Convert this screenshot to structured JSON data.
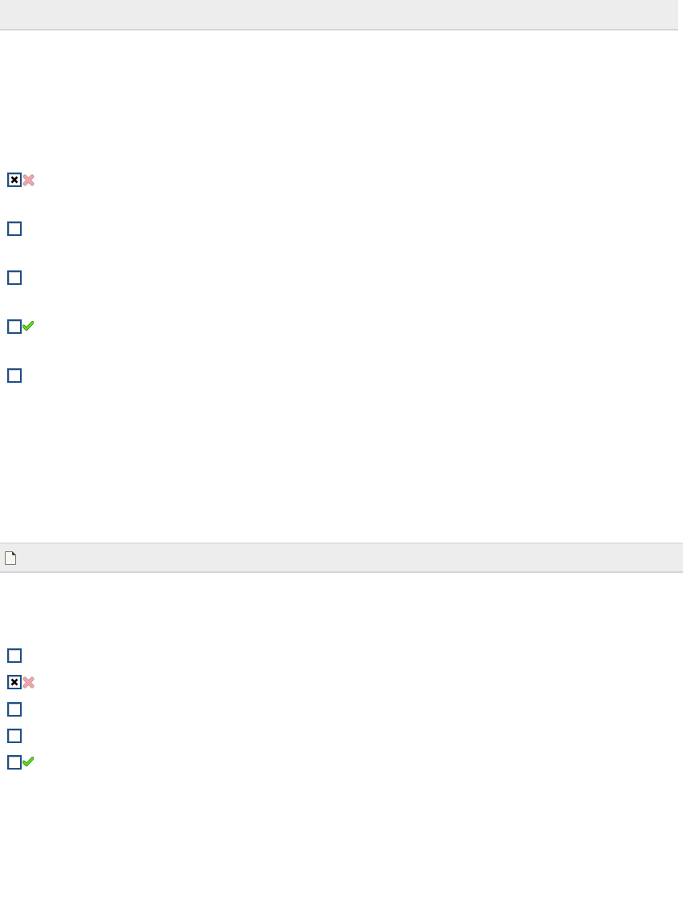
{
  "panels": [
    {
      "kind": "plain",
      "options": [
        {
          "kind": "wrong",
          "checked": true
        },
        {
          "kind": "plain",
          "checked": false
        },
        {
          "kind": "plain",
          "checked": false
        },
        {
          "kind": "correct",
          "checked": false
        },
        {
          "kind": "plain",
          "checked": false
        }
      ]
    },
    {
      "kind": "document",
      "options": [
        {
          "kind": "plain",
          "checked": false
        },
        {
          "kind": "wrong",
          "checked": true
        },
        {
          "kind": "plain",
          "checked": false
        },
        {
          "kind": "plain",
          "checked": false
        },
        {
          "kind": "correct",
          "checked": false
        }
      ]
    }
  ]
}
